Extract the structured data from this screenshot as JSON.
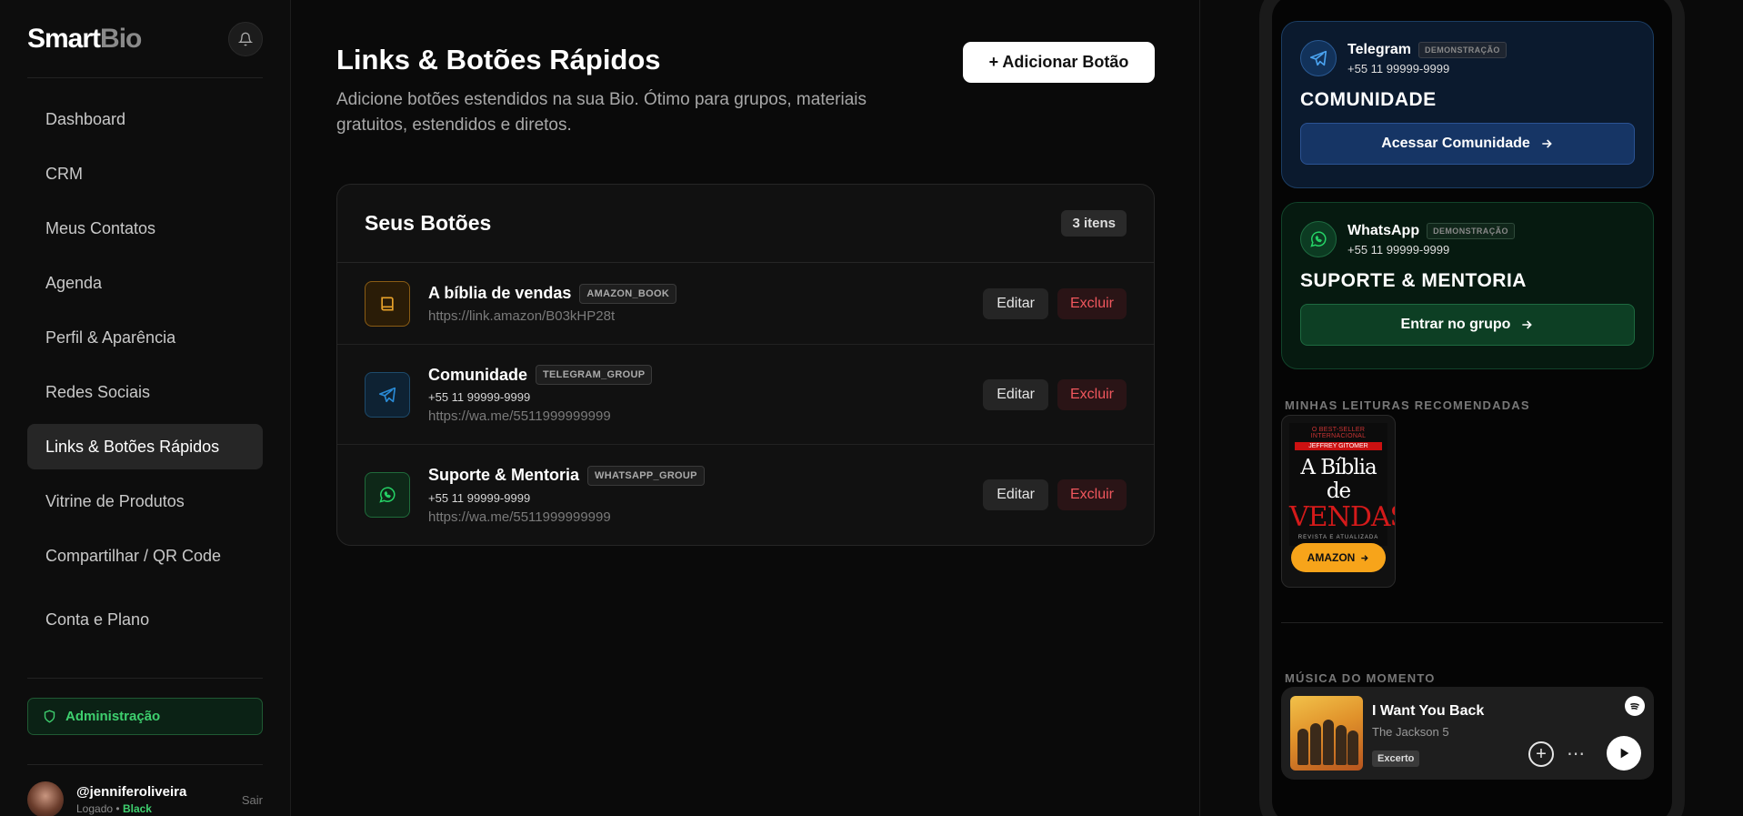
{
  "sidebar": {
    "logo_primary": "Smart",
    "logo_secondary": "Bio",
    "items": [
      {
        "label": "Dashboard"
      },
      {
        "label": "CRM"
      },
      {
        "label": "Meus Contatos"
      },
      {
        "label": "Agenda"
      },
      {
        "label": "Perfil & Aparência"
      },
      {
        "label": "Redes Sociais"
      },
      {
        "label": "Links & Botões Rápidos",
        "active": true
      },
      {
        "label": "Vitrine de Produtos"
      },
      {
        "label": "Compartilhar / QR Code"
      },
      {
        "label": "Conta e Plano"
      }
    ],
    "admin_label": "Administração",
    "user": {
      "handle": "@jenniferoliveira",
      "status": "Logado",
      "separator": "•",
      "plan": "Black",
      "logout": "Sair"
    }
  },
  "main": {
    "title": "Links & Botões Rápidos",
    "description": "Adicione botões estendidos na sua Bio. Ótimo para grupos, materiais gratuitos, estendidos e diretos.",
    "add_button": "+ Adicionar Botão",
    "card": {
      "title": "Seus Botões",
      "count": "3 itens",
      "rows": [
        {
          "name": "A bíblia de vendas",
          "tag": "AMAZON_BOOK",
          "phone": "",
          "url": "https://link.amazon/B03kHP28t",
          "edit": "Editar",
          "delete": "Excluir"
        },
        {
          "name": "Comunidade",
          "tag": "TELEGRAM_GROUP",
          "phone": "+55 11 99999-9999",
          "url": "https://wa.me/5511999999999",
          "edit": "Editar",
          "delete": "Excluir"
        },
        {
          "name": "Suporte & Mentoria",
          "tag": "WHATSAPP_GROUP",
          "phone": "+55 11 99999-9999",
          "url": "https://wa.me/5511999999999",
          "edit": "Editar",
          "delete": "Excluir"
        }
      ]
    }
  },
  "preview": {
    "telegram": {
      "name": "Telegram",
      "badge": "DEMONSTRAÇÃO",
      "phone": "+55 11 99999-9999",
      "title": "COMUNIDADE",
      "button": "Acessar Comunidade"
    },
    "whatsapp": {
      "name": "WhatsApp",
      "badge": "DEMONSTRAÇÃO",
      "phone": "+55 11 99999-9999",
      "title": "SUPORTE & MENTORIA",
      "button": "Entrar no grupo"
    },
    "reads_section": "MINHAS LEITURAS RECOMENDADAS",
    "book": {
      "top_line": "O BEST-SELLER INTERNACIONAL",
      "author": "JEFFREY GITOMER",
      "title_line1": "A Bíblia de",
      "title_line2": "VENDAS",
      "subtitle": "REVISTA E ATUALIZADA",
      "button": "AMAZON"
    },
    "music_section": "MÚSICA DO MOMENTO",
    "music": {
      "title": "I Want You Back",
      "artist": "The Jackson 5",
      "tag": "Excerto"
    }
  },
  "colors": {
    "accent_green": "#3ecf6e",
    "danger": "#f0575d",
    "amazon": "#f7a41a",
    "telegram_blue": "#2a8bd6",
    "whatsapp_green": "#25d366"
  }
}
